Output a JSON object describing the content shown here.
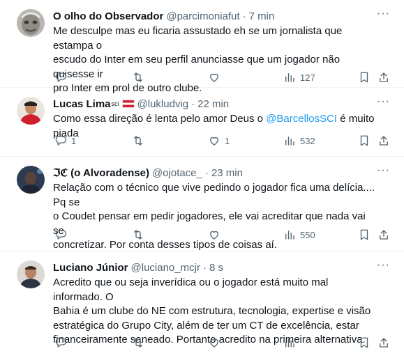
{
  "tweets": [
    {
      "name": "O olho do Observador",
      "handle": "@parcimoniafut",
      "time": "7 min",
      "text_lines": [
        "Me desculpe mas eu ficaria assustado eh se um jornalista que estampa o",
        "escudo do Inter em seu perfil anunciasse que um jogador não quisesse ir",
        "pro Inter em prol de outro clube."
      ],
      "counts": {
        "reply": "",
        "retweet": "",
        "like": "",
        "views": "127"
      }
    },
    {
      "name": "Lucas Lima",
      "name_suffix": "sci",
      "handle": "@lukludvig",
      "time": "22 min",
      "text_before": "Como essa direção é lenta pelo amor Deus o ",
      "mention": "@BarcellosSCI",
      "text_after": " é muito piada",
      "counts": {
        "reply": "1",
        "retweet": "",
        "like": "1",
        "views": "532"
      }
    },
    {
      "name": "ℑℭ (o Alvoradense)",
      "handle": "@ojotace_",
      "time": "23 min",
      "text_lines": [
        "Relação com o técnico que vive pedindo o jogador fica uma delícia.... Pq se",
        "o Coudet pensar em pedir jogadores, ele vai acreditar que nada vai se",
        "concretizar. Por conta desses tipos de coisas aí."
      ],
      "counts": {
        "reply": "",
        "retweet": "",
        "like": "",
        "views": "550"
      }
    },
    {
      "name": "Luciano Júnior",
      "handle": "@luciano_mcjr",
      "time": "8 s",
      "text_lines": [
        "Acredito que ou seja inverídica ou o jogador está muito mal informado. O",
        "Bahia é um clube do NE com estrutura, tecnologia, expertise e visão",
        "estratégica do Grupo City, além de ter um CT de excelência, estar",
        "financeiramente saneado. Portanto acredito na primeira alternativa."
      ],
      "counts": {
        "reply": "",
        "retweet": "",
        "like": "",
        "views": ""
      }
    }
  ],
  "separator": "·",
  "more_glyph": "···",
  "colors": {
    "text": "#0f1419",
    "secondary": "#536471",
    "link": "#1d9bf0",
    "border": "#eff3f4"
  },
  "icons": [
    "reply-icon",
    "retweet-icon",
    "like-icon",
    "views-icon",
    "bookmark-icon",
    "share-icon",
    "more-icon"
  ]
}
